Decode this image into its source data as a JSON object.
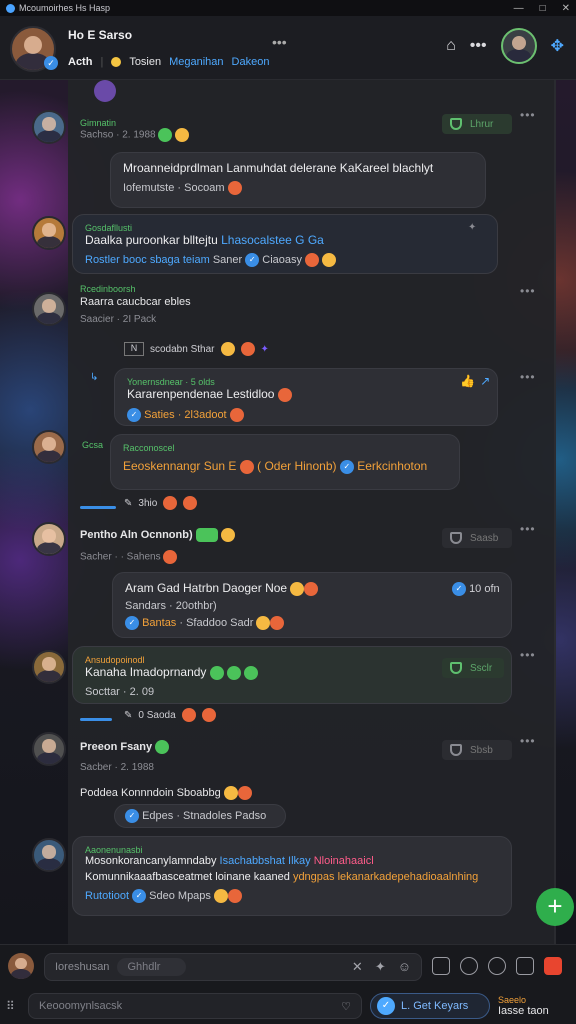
{
  "window": {
    "title": "Mcoumoirhes Hs Hasp",
    "controls": [
      "—",
      "□",
      "✕"
    ]
  },
  "header": {
    "title": "Ho E Sarso",
    "name": "Acth",
    "links": [
      "Tosien",
      "Meganihan",
      "Dakeon"
    ],
    "more": "•••"
  },
  "messages": [
    {
      "id": "m1",
      "name": "Gimnatin",
      "meta": "Sachso · 2. 1988",
      "badge": "Lhrur"
    },
    {
      "id": "m2",
      "line1": "Mroanneidprdlman Lanmuhdat delerane KaKareel blachlyt",
      "line2": "Iofemutste · Socoam"
    },
    {
      "id": "m3",
      "tag": "Gosdafllusti",
      "line1_a": "Daalka puroonkar blltejtu",
      "line1_b": "Lhasocalstee",
      "line1_c": "G Ga",
      "line2_a": "Rostler",
      "line2_b": "booc sbaga teiam",
      "line2_c": "Saner",
      "line2_d": "Ciaoasy"
    },
    {
      "id": "m4",
      "tag": "Rcedinboorsh",
      "name": "Raarra caucbcar ebles",
      "meta": "Saacier · 2I Pack"
    },
    {
      "id": "m5",
      "sys": "scodabn Sthar"
    },
    {
      "id": "m6",
      "tag": "Yonernsdnear · 5 olds",
      "line1": "Kararenpendenae Lestidloo",
      "line2": "Saties · 2l3adoot"
    },
    {
      "id": "m7",
      "tag": "Racconoscel",
      "line1_a": "Eeoskennangr",
      "line1_b": "Sun E",
      "line1_c": "( Oder Hinonb)",
      "line1_d": "Eerkcinhoton"
    },
    {
      "id": "m8",
      "sys": "3hio"
    },
    {
      "id": "m9",
      "name": "Pentho Aln Ocnnonb)",
      "meta": "Sacher · · Sahens",
      "badge": "Saasb"
    },
    {
      "id": "m10",
      "line1": "Aram Gad Hatrbn Daoger Noe",
      "count": "10 ofn",
      "line2": "Sandars · 20othbr)",
      "line3_a": "Bantas",
      "line3_b": "Sfaddoo Sadr"
    },
    {
      "id": "m11",
      "tag": "Ansudopoinodl",
      "name": "Kanaha Imadoprnandy",
      "meta": "Socttar · 2. 09",
      "badge": "Ssclr"
    },
    {
      "id": "m12",
      "sys": "0 Saoda"
    },
    {
      "id": "m13",
      "name": "Preeon Fsany",
      "meta": "Sacber · 2. 1988"
    },
    {
      "id": "m14",
      "name": "Poddea Konnndoin Sboabbg",
      "chip_a": "Edpes",
      "chip_b": "Stnadoles Padso"
    },
    {
      "id": "m15",
      "tag": "Aaonenunasbi",
      "line1_a": "Mosonkorancanylamndaby",
      "line1_b": "Isachabbshat Ilkay",
      "line1_c": "Nloinahaaicl",
      "line2_a": "Komunnikaaafbasceatmet loinane kaaned",
      "line2_b": "ydngpas lekanarkadepehadioaalnhing",
      "line3_a": "Rutotioot",
      "line3_b": "Sdeo Mpaps"
    }
  ],
  "composer": {
    "placeholder": "Ioreshusan",
    "pill": "Ghhdlr",
    "search_placeholder": "Keooomynlsacsk",
    "get_label": "L. Get Keyars",
    "price_top": "Saeelo",
    "price_bottom": "Iasse taon"
  },
  "colors": {
    "accent": "#4ea9ff",
    "green": "#2fae4c",
    "panel": "#222328"
  }
}
